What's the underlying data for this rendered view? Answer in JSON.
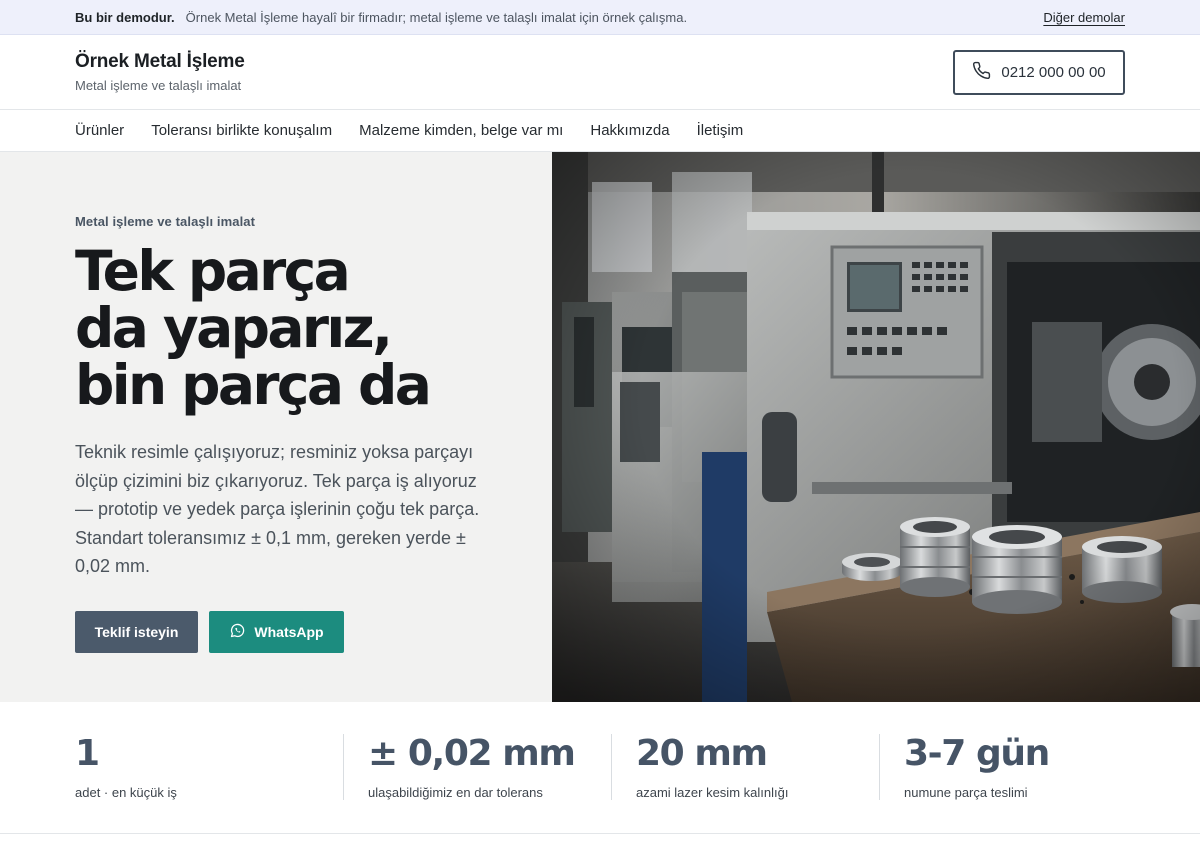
{
  "demo_bar": {
    "label": "Bu bir demodur.",
    "text": "Örnek Metal İşleme hayalî bir firmadır; metal işleme ve talaşlı imalat için örnek çalışma.",
    "other_demos": "Diğer demolar"
  },
  "header": {
    "brand_title": "Örnek Metal İşleme",
    "brand_subtitle": "Metal işleme ve talaşlı imalat",
    "phone": "0212 000 00 00"
  },
  "nav": {
    "items": [
      {
        "label": "Ürünler"
      },
      {
        "label": "Toleransı birlikte konuşalım"
      },
      {
        "label": "Malzeme kimden, belge var mı"
      },
      {
        "label": "Hakkımızda"
      },
      {
        "label": "İletişim"
      }
    ]
  },
  "hero": {
    "eyebrow": "Metal işleme ve talaşlı imalat",
    "title_lines": [
      "Tek parça",
      "da yaparız,",
      "bin parça da"
    ],
    "description": "Teknik resimle çalışıyoruz; resminiz yoksa parçayı ölçüp çizimini biz çıkarıyoruz. Tek parça iş alıyoruz — prototip ve yedek parça işlerinin çoğu tek parça. Standart toleransımız ± 0,1 mm, gereken yerde ± 0,02 mm.",
    "cta_primary": "Teklif isteyin",
    "cta_whatsapp": "WhatsApp"
  },
  "stats": [
    {
      "value": "1",
      "label": "adet · en küçük iş"
    },
    {
      "value": "± 0,02 mm",
      "label": "ulaşabildiğimiz en dar tolerans"
    },
    {
      "value": "20 mm",
      "label": "azami lazer kesim kalınlığı"
    },
    {
      "value": "3-7 gün",
      "label": "numune parça teslimi"
    }
  ],
  "colors": {
    "demo_bar_bg": "#eef0fb",
    "primary_button": "#4b5a6b",
    "whatsapp_button": "#1c8c7f",
    "stat_value": "#465466",
    "hero_left_bg": "#f2f2f1"
  },
  "icons": {
    "phone": "phone-icon",
    "whatsapp": "whatsapp-icon"
  }
}
